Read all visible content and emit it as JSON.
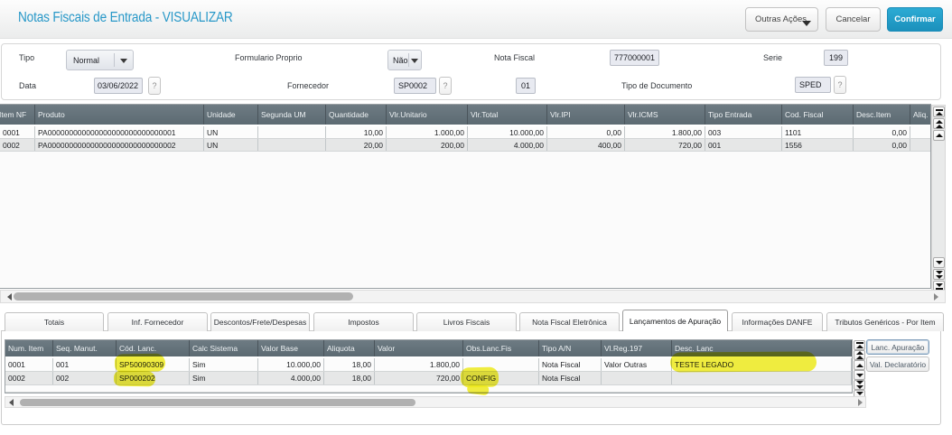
{
  "window": {
    "title": "Notas Fiscais de Entrada - VISUALIZAR"
  },
  "header_buttons": {
    "outras_acoes": "Outras Ações",
    "cancelar": "Cancelar",
    "confirmar": "Confirmar"
  },
  "form": {
    "tipo": {
      "label": "Tipo",
      "value": "Normal"
    },
    "formulario_proprio": {
      "label": "Formulario Proprio",
      "value": "Não"
    },
    "nota_fiscal": {
      "label": "Nota Fiscal",
      "value": "777000001"
    },
    "serie": {
      "label": "Serie",
      "value": "199"
    },
    "data": {
      "label": "Data",
      "value": "03/06/2022"
    },
    "fornecedor": {
      "label": "Fornecedor",
      "value": "SP0002"
    },
    "loja": {
      "value": "01"
    },
    "tipo_documento": {
      "label": "Tipo de Documento",
      "value": "SPED"
    },
    "help_button": "?"
  },
  "items_grid": {
    "headers": [
      "Item NF",
      "Produto",
      "Unidade",
      "Segunda UM",
      "Quantidade",
      "Vlr.Unitario",
      "Vlr.Total",
      "Vlr.IPI",
      "Vlr.ICMS",
      "Tipo Entrada",
      "Cod. Fiscal",
      "Desc.Item",
      "Aliq. IPI"
    ],
    "rows": [
      [
        "0001",
        "PA000000000000000000000000000001",
        "UN",
        "",
        "10,00",
        "1.000,00",
        "10.000,00",
        "0,00",
        "1.800,00",
        "003",
        "1101",
        "0,00",
        ""
      ],
      [
        "0002",
        "PA000000000000000000000000000002",
        "UN",
        "",
        "20,00",
        "200,00",
        "4.000,00",
        "400,00",
        "720,00",
        "001",
        "1556",
        "0,00",
        ""
      ]
    ]
  },
  "tabs": {
    "active": "Lançamentos de Apuração",
    "items": [
      "Totais",
      "Inf. Fornecedor",
      "Descontos/Frete/Despesas",
      "Impostos",
      "Livros Fiscais",
      "Nota Fiscal Eletrônica",
      "Lançamentos de Apuração",
      "Informações DANFE",
      "Tributos Genéricos - Por Item"
    ]
  },
  "apuracao_grid": {
    "headers": [
      "Num. Item",
      "Seq. Manut.",
      "Cód. Lanc.",
      "Calc Sistema",
      "Valor Base",
      "Aliquota",
      "Valor",
      "Obs.Lanc.Fis",
      "Tipo A/N",
      "Vl.Reg.197",
      "Desc. Lanc"
    ],
    "rows": [
      [
        "0001",
        "001",
        "SP50090309",
        "Sim",
        "10.000,00",
        "18,00",
        "1.800,00",
        "",
        "Nota Fiscal",
        "Valor Outras",
        "TESTE LEGADO"
      ],
      [
        "0002",
        "002",
        "SP000202",
        "Sim",
        "4.000,00",
        "18,00",
        "720,00",
        "CONFIG",
        "Nota Fiscal",
        "",
        ""
      ]
    ]
  },
  "side_buttons": {
    "lanc_apuracao": "Lanc. Apuração",
    "val_declaratorio": "Val. Declaratório"
  },
  "annotations": {
    "highlight_color": "#f0ec1f",
    "highlighted_values": [
      "SP50090309",
      "SP000202",
      "CONFIG",
      "TESTE LEGADO"
    ]
  },
  "icons": {
    "dropdown": "caret-down-icon",
    "scroll": [
      "first-icon",
      "page-up-icon",
      "up-icon",
      "down-icon",
      "page-down-icon",
      "last-icon"
    ]
  }
}
